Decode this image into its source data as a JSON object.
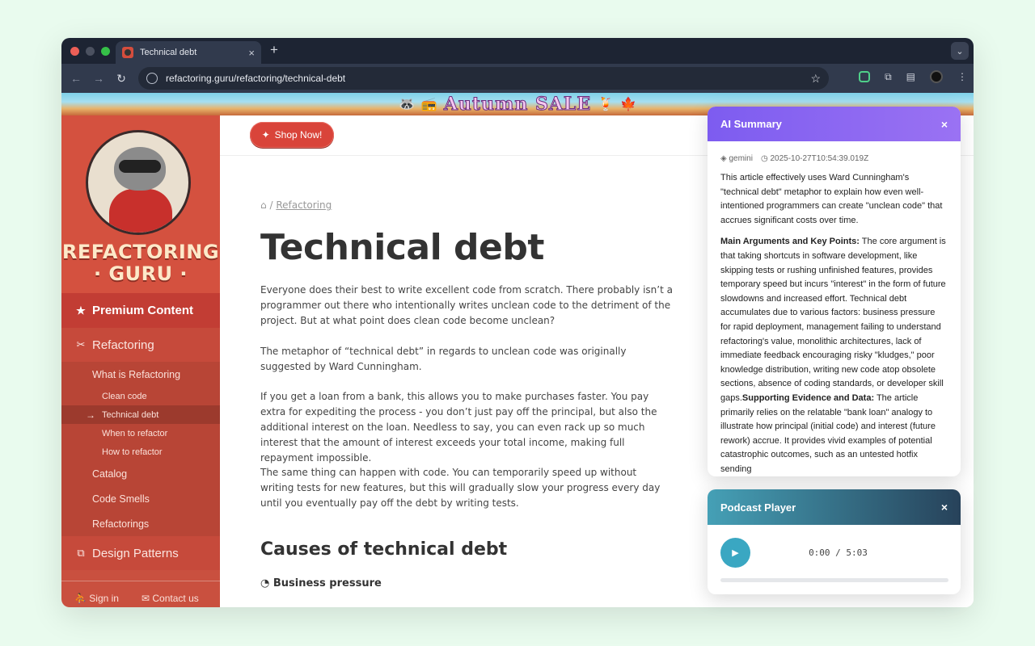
{
  "browser": {
    "tab_title": "Technical debt",
    "tab_close": "×",
    "new_tab": "+",
    "url": "refactoring.guru/refactoring/technical-debt"
  },
  "banner": {
    "text": "Autumn SALE"
  },
  "sidebar": {
    "logo_line1": "REFACTORING",
    "logo_line2": "· GURU ·",
    "premium": "Premium Content",
    "refactoring": "Refactoring",
    "what_is": "What is Refactoring",
    "clean_code": "Clean code",
    "technical_debt": "Technical debt",
    "when_to": "When to refactor",
    "how_to": "How to refactor",
    "catalog": "Catalog",
    "code_smells": "Code Smells",
    "refactorings": "Refactorings",
    "design_patterns": "Design Patterns",
    "sign_in": "Sign in",
    "contact": "Contact us"
  },
  "main": {
    "shop_now": "Shop Now!",
    "breadcrumb_sep": "/",
    "breadcrumb_link": "Refactoring",
    "title": "Technical debt",
    "p1": "Everyone does their best to write excellent code from scratch. There probably isn’t a programmer out there who intentionally writes unclean code to the detriment of the project. But at what point does clean code become unclean?",
    "p2": "The metaphor of “technical debt” in regards to unclean code was originally suggested by Ward Cunningham.",
    "p3": "If you get a loan from a bank, this allows you to make purchases faster. You pay extra for expediting the process - you don’t just pay off the principal, but also the additional interest on the loan. Needless to say, you can even rack up so much interest that the amount of interest exceeds your total income, making full repayment impossible.",
    "p4": "The same thing can happen with code. You can temporarily speed up without writing tests for new features, but this will gradually slow your progress every day until you eventually pay off the debt by writing tests.",
    "h2": "Causes of technical debt",
    "h3": "Business pressure"
  },
  "ai_summary": {
    "title": "AI Summary",
    "close": "×",
    "model": "gemini",
    "timestamp": "2025-10-27T10:54:39.019Z",
    "intro": "This article effectively uses Ward Cunningham's \"technical debt\" metaphor to explain how even well-intentioned programmers can create \"unclean code\" that accrues significant costs over time.",
    "main_label": "Main Arguments and Key Points:",
    "main_text": " The core argument is that taking shortcuts in software development, like skipping tests or rushing unfinished features, provides temporary speed but incurs \"interest\" in the form of future slowdowns and increased effort. Technical debt accumulates due to various factors: business pressure for rapid deployment, management failing to understand refactoring's value, monolithic architectures, lack of immediate feedback encouraging risky \"kludges,\" poor knowledge distribution, writing new code atop obsolete sections, absence of coding standards, or developer skill gaps.",
    "evidence_label": "Supporting Evidence and Data:",
    "evidence_text": " The article primarily relies on the relatable \"bank loan\" analogy to illustrate how principal (initial code) and interest (future rework) accrue. It provides vivid examples of potential catastrophic outcomes, such as an untested hotfix sending"
  },
  "podcast": {
    "title": "Podcast Player",
    "close": "×",
    "time": "0:00 / 5:03",
    "progress": 0
  }
}
